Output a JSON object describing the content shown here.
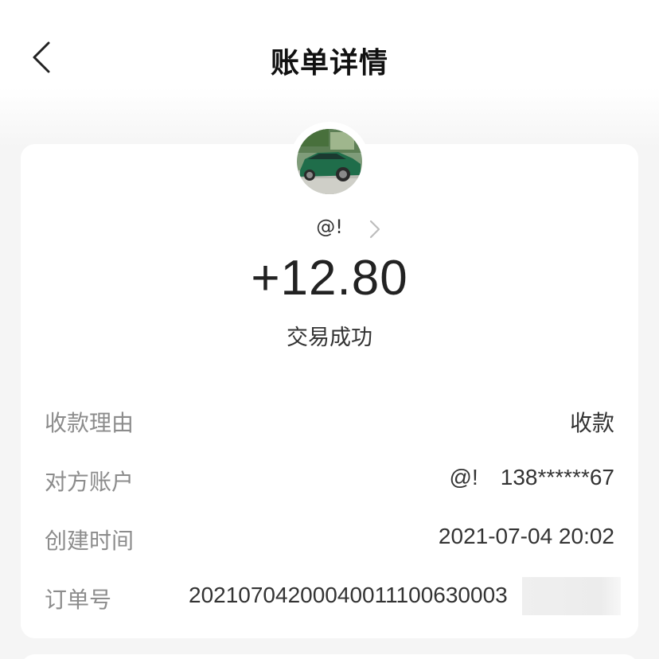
{
  "header": {
    "title": "账单详情",
    "back_icon": "chevron-left-icon"
  },
  "payer": {
    "name": "@!",
    "avatar": "car-photo",
    "chevron_icon": "chevron-right-icon"
  },
  "transaction": {
    "amount": "+12.80",
    "status": "交易成功"
  },
  "details": {
    "reason_label": "收款理由",
    "reason_value": "收款",
    "account_label": "对方账户",
    "account_name": "@!",
    "account_number": "138******67",
    "time_label": "创建时间",
    "time_value": "2021-07-04 20:02",
    "order_label": "订单号",
    "order_value": "20210704200040011100630003"
  },
  "colors": {
    "background": "#f5f5f5",
    "card": "#ffffff",
    "label": "#8c8c8c",
    "text": "#333333"
  }
}
